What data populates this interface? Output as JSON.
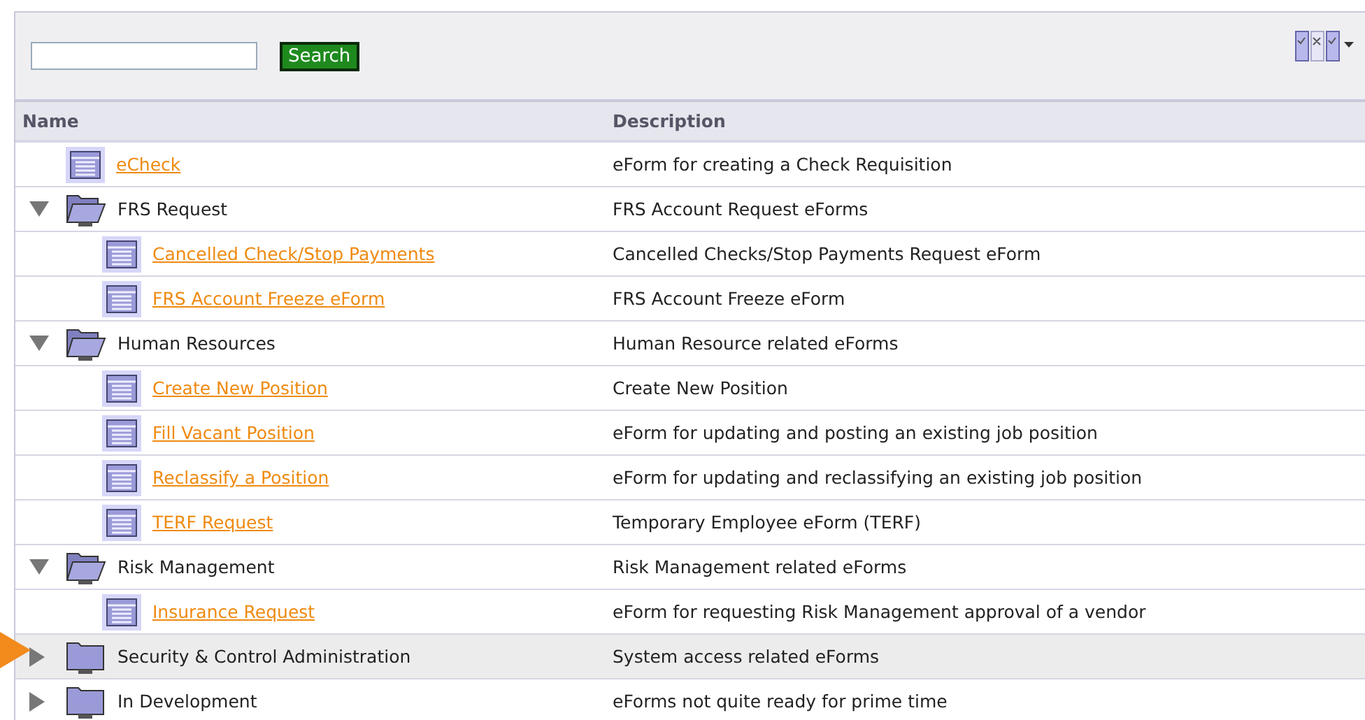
{
  "search": {
    "button": "Search"
  },
  "table": {
    "columns": [
      "Name",
      "Description"
    ],
    "rows": [
      {
        "kind": "form",
        "name": "eCheck",
        "description": "eForm for creating a Check Requisition",
        "selected": false
      },
      {
        "kind": "folder",
        "name": "FRS Request",
        "description": "FRS Account Request eForms",
        "expanded": true,
        "selected": false,
        "children": [
          {
            "kind": "form",
            "name": "Cancelled Check/Stop Payments",
            "description": "Cancelled Checks/Stop Payments Request eForm",
            "selected": false
          },
          {
            "kind": "form",
            "name": "FRS Account Freeze eForm",
            "description": "FRS Account Freeze eForm",
            "selected": false
          }
        ]
      },
      {
        "kind": "folder",
        "name": "Human Resources",
        "description": "Human Resource related eForms",
        "expanded": true,
        "selected": false,
        "children": [
          {
            "kind": "form",
            "name": "Create New Position",
            "description": "Create New Position",
            "selected": false
          },
          {
            "kind": "form",
            "name": "Fill Vacant Position",
            "description": "eForm for updating and posting an existing job position",
            "selected": false
          },
          {
            "kind": "form",
            "name": "Reclassify a Position",
            "description": "eForm for updating and reclassifying an existing job position",
            "selected": false
          },
          {
            "kind": "form",
            "name": "TERF Request",
            "description": "Temporary Employee eForm (TERF)",
            "selected": false
          }
        ]
      },
      {
        "kind": "folder",
        "name": "Risk Management",
        "description": "Risk Management related eForms",
        "expanded": true,
        "selected": false,
        "children": [
          {
            "kind": "form",
            "name": "Insurance Request",
            "description": "eForm for requesting Risk Management approval of a vendor",
            "selected": false
          }
        ]
      },
      {
        "kind": "folder",
        "name": "Security & Control Administration",
        "description": "System access related eForms",
        "expanded": false,
        "selected": true
      },
      {
        "kind": "folder",
        "name": "In Development",
        "description": "eForms not quite ready for prime time",
        "expanded": false,
        "selected": false
      }
    ]
  }
}
